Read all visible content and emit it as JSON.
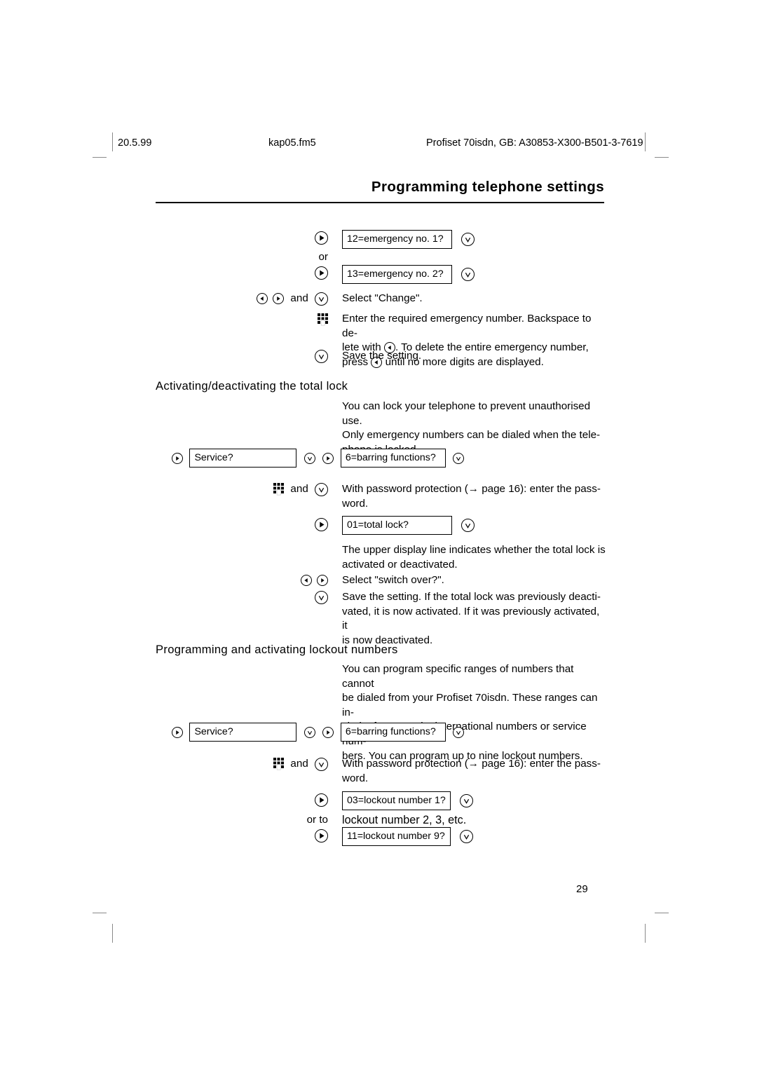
{
  "running_head": {
    "date": "20.5.99",
    "file": "kap05.fm5",
    "document": "Profiset 70isdn, GB: A30853-X300-B501-3-7619"
  },
  "chapter_title": "Programming telephone settings",
  "page_number": "29",
  "icons": {
    "right_arrow": "right-arrow-button-icon",
    "left_arrow": "left-arrow-button-icon",
    "check": "check-confirm-button-icon",
    "keypad": "keypad-digits-icon",
    "cross_ref_arrow": "→"
  },
  "emergency_section": {
    "steps": [
      {
        "gutter_icons": [
          "right_arrow"
        ],
        "display": "12=emergency no. 1?",
        "trailing_icon": "check"
      },
      {
        "connector": "or"
      },
      {
        "gutter_icons": [
          "right_arrow"
        ],
        "display": "13=emergency no. 2?",
        "trailing_icon": "check"
      },
      {
        "gutter_icons": [
          "left_arrow",
          "right_arrow"
        ],
        "gutter_text": "and",
        "gutter_trailing_icon": "check",
        "text": "Select \"Change\"."
      },
      {
        "gutter_icons": [
          "keypad"
        ],
        "text_parts": [
          "Enter the required emergency number. Backspace to de-",
          "lete with ",
          ". To delete the entire emergency number,",
          "press ",
          " until no more digits are displayed."
        ]
      },
      {
        "gutter_icons": [
          "check"
        ],
        "text": "Save the setting."
      }
    ]
  },
  "total_lock_section": {
    "heading": "Activating/deactivating the total lock",
    "intro": [
      "You can lock your telephone to prevent unauthorised use.",
      "Only emergency numbers can be dialed when the tele-",
      "phone is locked."
    ],
    "service_row": {
      "icon_1": "right_arrow",
      "display_1": "Service?",
      "icon_2": "check",
      "icon_3": "right_arrow",
      "display_2": "6=barring functions?",
      "icon_4": "check"
    },
    "password_step": {
      "gutter_icons": [
        "keypad"
      ],
      "gutter_text": "and",
      "gutter_trailing_icon": "check",
      "text_before": "With password protection (",
      "text_after": " page 16): enter the pass-",
      "text_line2": "word."
    },
    "total_lock_row": {
      "gutter_icons": [
        "right_arrow"
      ],
      "display": "01=total lock?",
      "trailing_icon": "check"
    },
    "display_note": [
      "The upper display line indicates whether the total lock is",
      "activated or deactivated."
    ],
    "switch_step": {
      "gutter_icons": [
        "left_arrow",
        "right_arrow"
      ],
      "text": "Select \"switch over?\"."
    },
    "save_step": {
      "gutter_icons": [
        "check"
      ],
      "text": [
        "Save the setting. If the total lock was previously deacti-",
        "vated, it is now activated. If it was previously activated, it",
        "is now deactivated."
      ]
    }
  },
  "lockout_section": {
    "heading": "Programming and activating lockout numbers",
    "intro": [
      "You can program specific ranges of numbers that cannot",
      "be dialed from your Profiset 70isdn. These ranges can in-",
      "clude, for example, international numbers or service num-",
      "bers. You can program up to nine lockout numbers."
    ],
    "service_row": {
      "icon_1": "right_arrow",
      "display_1": "Service?",
      "icon_2": "check",
      "icon_3": "right_arrow",
      "display_2": "6=barring functions?",
      "icon_4": "check"
    },
    "password_step": {
      "gutter_icons": [
        "keypad"
      ],
      "gutter_text": "and",
      "gutter_trailing_icon": "check",
      "text_before": "With password protection (",
      "text_after": " page 16): enter the pass-",
      "text_line2": "word."
    },
    "lockout_first_row": {
      "gutter_icons": [
        "right_arrow"
      ],
      "display": "03=lockout number 1?",
      "trailing_icon": "check"
    },
    "or_to_label": "or to",
    "or_to_text": "lockout number 2, 3, etc.",
    "lockout_last_row": {
      "gutter_icons": [
        "right_arrow"
      ],
      "display": "11=lockout number 9?",
      "trailing_icon": "check"
    }
  }
}
